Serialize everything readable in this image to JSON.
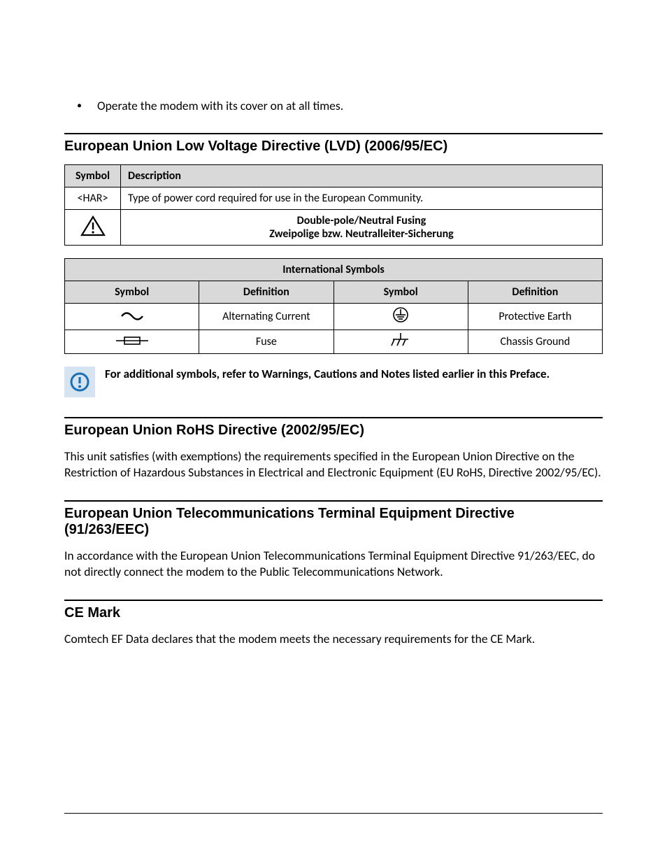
{
  "bullet": {
    "text": "Operate the modem with its cover on at all times."
  },
  "lvd": {
    "heading": "European Union Low Voltage Directive (LVD) (2006/95/EC)",
    "table1": {
      "headers": {
        "symbol": "Symbol",
        "description": "Description"
      },
      "row_har": {
        "symbol": "<HAR>",
        "desc": "Type of power cord required for use in the European Community."
      },
      "row_warn": {
        "line1": "Double-pole/Neutral Fusing",
        "line2": "Zweipolige bzw. Neutralleiter-Sicherung"
      }
    },
    "table2": {
      "title": "International Symbols",
      "headers": {
        "symbol": "Symbol",
        "definition": "Definition"
      },
      "rows": [
        {
          "def1": "Alternating Current",
          "def2": "Protective Earth"
        },
        {
          "def1": "Fuse",
          "def2": "Chassis Ground"
        }
      ]
    },
    "note": "For additional symbols, refer to Warnings, Cautions and Notes listed earlier in this Preface."
  },
  "rohs": {
    "heading": "European Union RoHS Directive (2002/95/EC)",
    "body": "This unit satisfies (with exemptions) the requirements specified in the European Union Directive on the Restriction of Hazardous Substances in Electrical and Electronic Equipment (EU RoHS, Directive 2002/95/EC)."
  },
  "tte": {
    "heading": "European Union Telecommunications Terminal Equipment Directive (91/263/EEC)",
    "body": "In accordance with the European Union Telecommunications Terminal Equipment Directive 91/263/EEC, do not directly connect the modem to the Public Telecommunications Network."
  },
  "ce": {
    "heading": "CE Mark",
    "body": "Comtech EF Data declares that the modem meets the necessary requirements for the CE Mark."
  }
}
